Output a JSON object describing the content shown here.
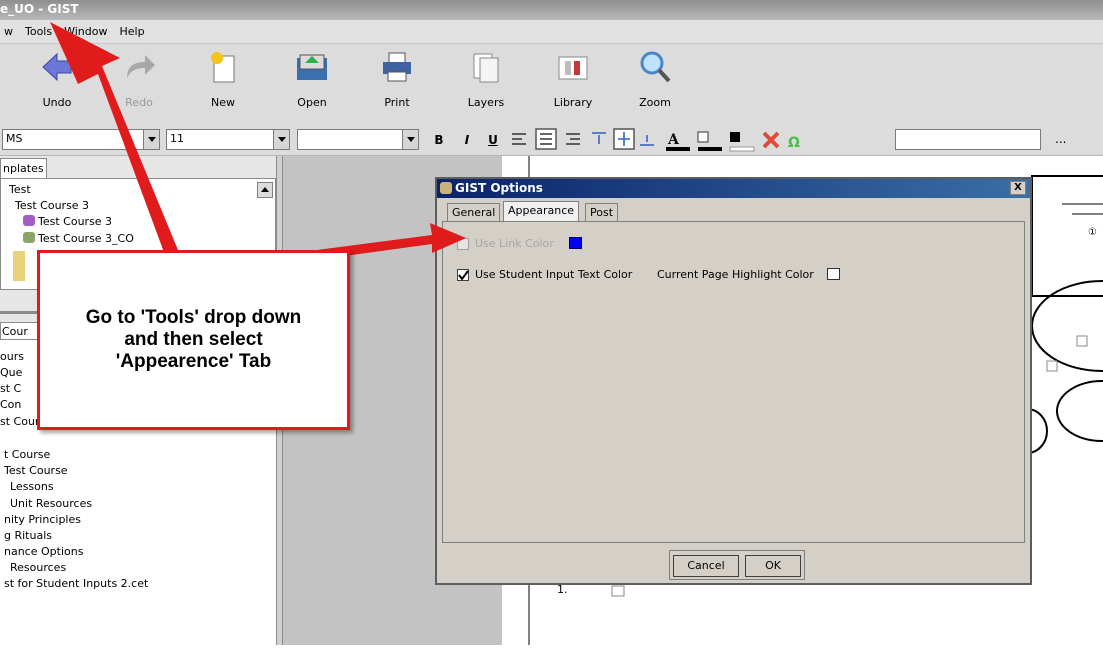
{
  "window": {
    "title": "e_UO - GIST"
  },
  "menu": [
    "w",
    "Tools",
    "Window",
    "Help"
  ],
  "toolbar": [
    {
      "label": "Undo",
      "icon": "undo-arrow-icon",
      "enabled": true
    },
    {
      "label": "Redo",
      "icon": "redo-arrow-icon",
      "enabled": false
    },
    {
      "label": "New",
      "icon": "new-document-icon",
      "enabled": true
    },
    {
      "label": "Open",
      "icon": "open-folder-icon",
      "enabled": true
    },
    {
      "label": "Print",
      "icon": "printer-icon",
      "enabled": true
    },
    {
      "label": "Layers",
      "icon": "layers-icon",
      "enabled": true
    },
    {
      "label": "Library",
      "icon": "library-book-icon",
      "enabled": true
    },
    {
      "label": "Zoom",
      "icon": "magnifier-icon",
      "enabled": true
    }
  ],
  "format": {
    "font": "MS",
    "size": "11",
    "style": "",
    "text_input": "",
    "more": "...",
    "bold": "B",
    "italic": "I",
    "underline": "U"
  },
  "left": {
    "templates_tab": "nplates",
    "templates": [
      "Test",
      "Test Course 3",
      "Test Course 3",
      "Test Course 3_CO"
    ],
    "course_tab": "Cour",
    "courses_hidden": [
      "ours",
      "Que",
      "st C",
      "Con",
      "st Course"
    ],
    "courses": [
      "t Course",
      "Test Course",
      "Lessons",
      "Unit Resources",
      "nity Principles",
      "g Rituals",
      "nance Options",
      "Resources",
      "st for Student Inputs 2.cet"
    ]
  },
  "dialog": {
    "title": "GIST Options",
    "close": "X",
    "tabs": [
      "General",
      "Appearance",
      "Post"
    ],
    "active_tab": "Appearance",
    "use_link_color": {
      "label": "Use Link Color",
      "checked": false,
      "enabled": false,
      "color": "#0000ff"
    },
    "use_student_input_color": {
      "label": "Use Student Input Text Color",
      "checked": true
    },
    "page_highlight": {
      "label": "Current Page Highlight Color"
    },
    "cancel": "Cancel",
    "ok": "OK"
  },
  "callout": {
    "text": "Go to 'Tools' drop down\nand then select\n'Appearence' Tab"
  },
  "canvas": {
    "label_1": "1."
  },
  "colors": {
    "arrow": "#e01b1b",
    "dialog_title": "#0a246a"
  }
}
